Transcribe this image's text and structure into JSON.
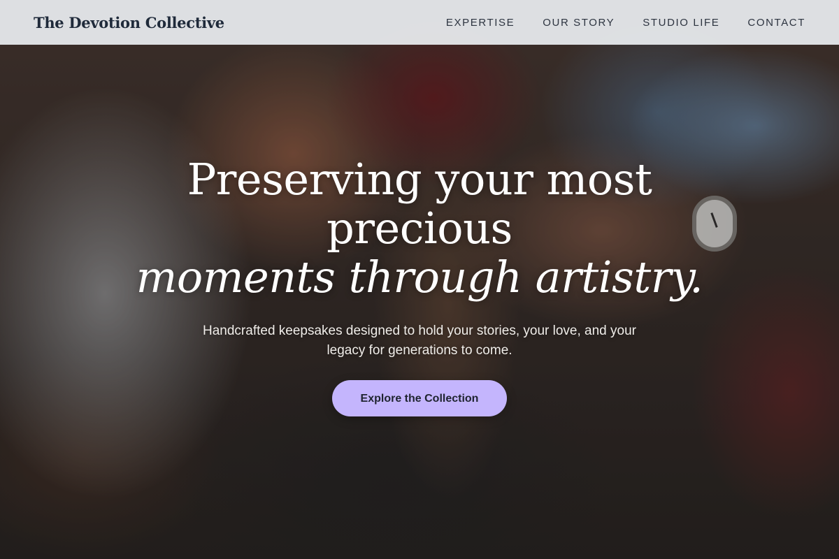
{
  "brand": {
    "name": "The Devotion Collective"
  },
  "nav": {
    "items": [
      {
        "label": "EXPERTISE"
      },
      {
        "label": "OUR STORY"
      },
      {
        "label": "STUDIO LIFE"
      },
      {
        "label": "CONTACT"
      }
    ]
  },
  "hero": {
    "headline_line1": "Preserving your most",
    "headline_line2": "precious",
    "headline_line3": "moments through artistry.",
    "subtitle": "Handcrafted keepsakes designed to hold your stories, your love, and your legacy for generations to come.",
    "cta_label": "Explore the Collection",
    "background_image": "craftsman-hands-working-leather"
  },
  "colors": {
    "navbar_bg": "#eceff2",
    "brand_text": "#1f2a3a",
    "cta_bg": "#c4b5fd",
    "cta_text": "#1f2430",
    "headline_text": "#ffffff"
  }
}
